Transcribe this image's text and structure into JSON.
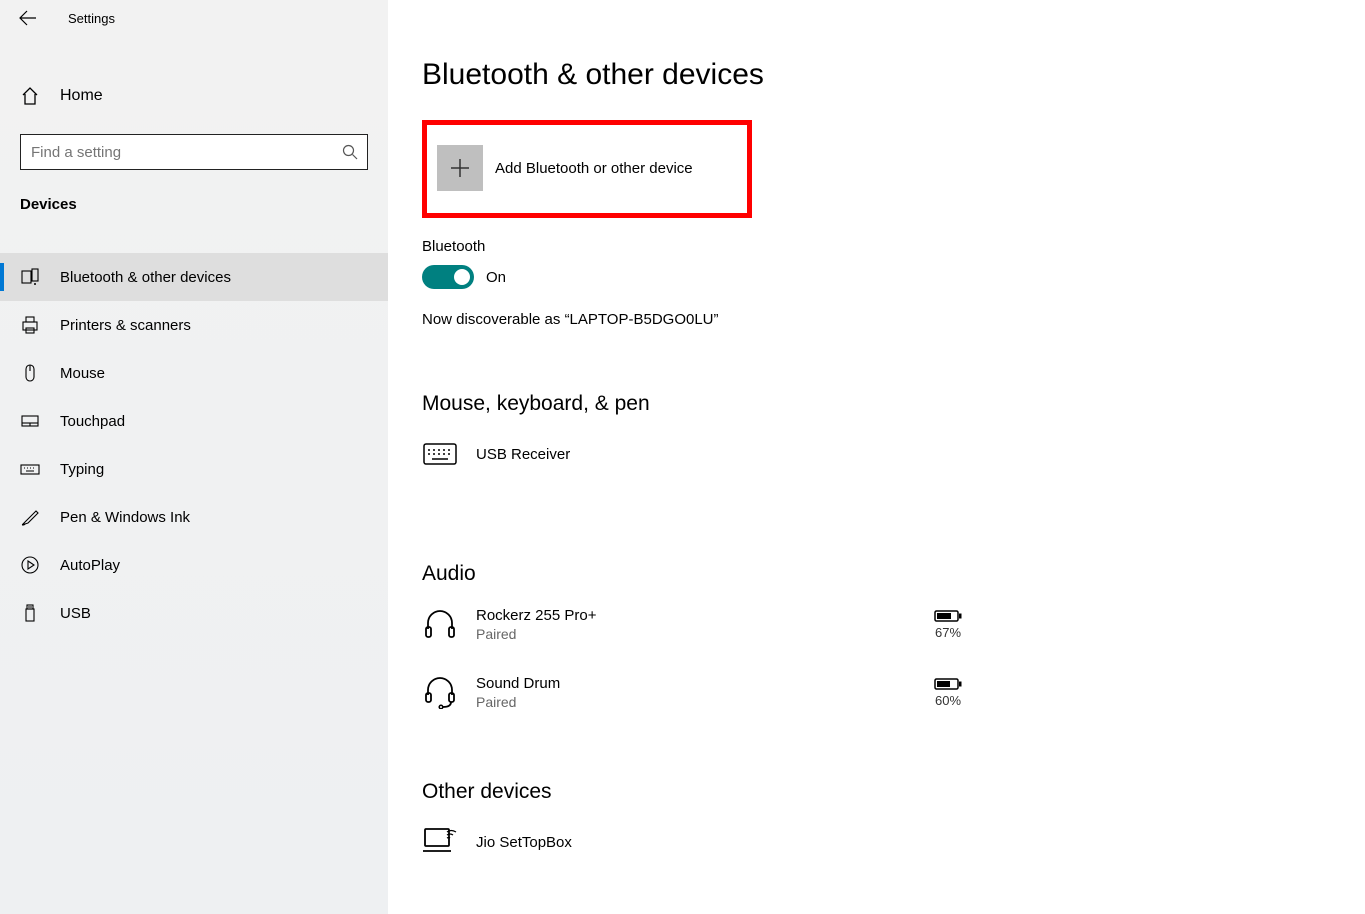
{
  "app": {
    "title": "Settings"
  },
  "sidebar": {
    "home": "Home",
    "search_placeholder": "Find a setting",
    "section": "Devices",
    "items": [
      {
        "label": "Bluetooth & other devices",
        "icon": "bluetooth-devices-icon",
        "active": true
      },
      {
        "label": "Printers & scanners",
        "icon": "printer-icon",
        "active": false
      },
      {
        "label": "Mouse",
        "icon": "mouse-icon",
        "active": false
      },
      {
        "label": "Touchpad",
        "icon": "touchpad-icon",
        "active": false
      },
      {
        "label": "Typing",
        "icon": "keyboard-icon",
        "active": false
      },
      {
        "label": "Pen & Windows Ink",
        "icon": "pen-icon",
        "active": false
      },
      {
        "label": "AutoPlay",
        "icon": "autoplay-icon",
        "active": false
      },
      {
        "label": "USB",
        "icon": "usb-icon",
        "active": false
      }
    ]
  },
  "main": {
    "title": "Bluetooth & other devices",
    "add_device": "Add Bluetooth or other device",
    "bluetooth_label": "Bluetooth",
    "bluetooth_state": "On",
    "discoverable": "Now discoverable as “LAPTOP-B5DGO0LU”",
    "sections": {
      "mouse": {
        "heading": "Mouse, keyboard, & pen",
        "devices": [
          {
            "name": "USB Receiver",
            "status": "",
            "battery": null,
            "icon": "keyboard"
          }
        ]
      },
      "audio": {
        "heading": "Audio",
        "devices": [
          {
            "name": "Rockerz 255 Pro+",
            "status": "Paired",
            "battery": "67%",
            "icon": "headphones"
          },
          {
            "name": "Sound Drum",
            "status": "Paired",
            "battery": "60%",
            "icon": "headset"
          }
        ]
      },
      "other": {
        "heading": "Other devices",
        "devices": [
          {
            "name": "Jio SetTopBox",
            "status": "",
            "battery": null,
            "icon": "screen"
          }
        ]
      }
    }
  }
}
